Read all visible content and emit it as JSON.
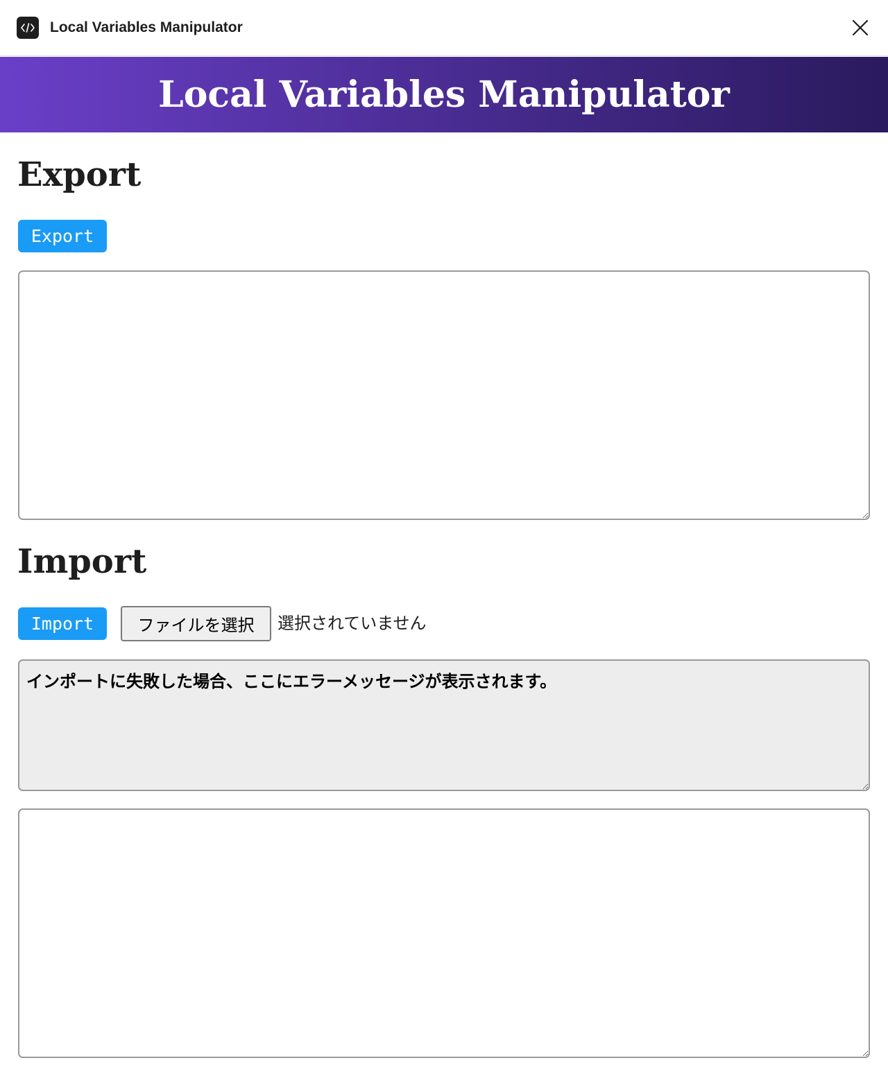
{
  "window": {
    "title": "Local Variables Manipulator",
    "icon": "code-brackets-icon",
    "close_icon": "close-icon"
  },
  "banner": {
    "title": "Local Variables Manipulator",
    "gradient_start": "#6a3fc8",
    "gradient_end": "#2a1a5e"
  },
  "export_section": {
    "heading": "Export",
    "button_label": "Export",
    "output_value": ""
  },
  "import_section": {
    "heading": "Import",
    "button_label": "Import",
    "file_button_label": "ファイルを選択",
    "file_status": "選択されていません",
    "error_placeholder": "インポートに失敗した場合、ここにエラーメッセージが表示されます。",
    "input_value": ""
  },
  "colors": {
    "button_bg": "#1a9bf5",
    "button_text": "#ffffff"
  }
}
